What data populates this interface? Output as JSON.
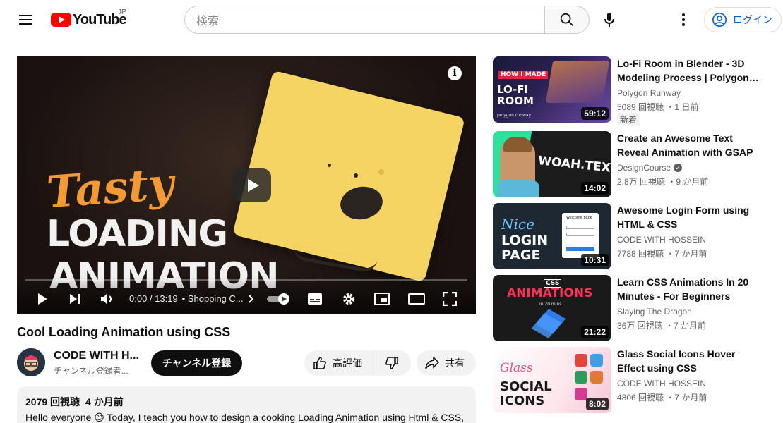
{
  "header": {
    "logo_text": "YouTube",
    "region": "JP",
    "search_placeholder": "検索",
    "login_label": "ログイン",
    "icons": [
      "menu-icon",
      "search-icon",
      "mic-icon",
      "more-vert-icon",
      "account-icon"
    ]
  },
  "player": {
    "thumbnail_text": {
      "line1": "Tasty",
      "line2": "LOADING",
      "line3": "ANIMATION"
    },
    "time": "0:00 / 13:19",
    "chapter": "• Shopping C...",
    "progress": 0
  },
  "video": {
    "title": "Cool Loading Animation using CSS",
    "channel_name": "CODE WITH H...",
    "channel_subs": "チャンネル登録者...",
    "subscribe_label": "チャンネル登録",
    "like_label": "高評価",
    "share_label": "共有",
    "views": "2079 回視聴",
    "published": "4 か月前",
    "description": "Hello everyone 😊 Today, I teach you how to design a cooking Loading Animation using Html & CSS,"
  },
  "related": [
    {
      "title": "Lo-Fi Room in Blender - 3D Modeling Process | Polygon…",
      "channel": "Polygon Runway",
      "verified": false,
      "stats": "5089 回視聴 ・1 日前",
      "badge": "新着",
      "duration": "59:12",
      "thumb_text": [
        "HOW I MADE",
        "LO-FI",
        "ROOM",
        "polygon runway"
      ],
      "colors": [
        "#1a1a3a",
        "#6b4ba8"
      ]
    },
    {
      "title": "Create an Awesome Text Reveal Animation with GSAP",
      "channel": "DesignCourse",
      "verified": true,
      "stats": "2.8万 回視聴 ・9 か月前",
      "duration": "14:02",
      "thumb_text": [
        "WOAH.TEXT"
      ],
      "colors": [
        "#1c1c1c",
        "#2de29a"
      ]
    },
    {
      "title": "Awesome Login Form using HTML & CSS",
      "channel": "CODE WITH HOSSEIN",
      "verified": false,
      "stats": "7788 回視聴 ・7 か月前",
      "duration": "10:31",
      "thumb_text": [
        "Nice",
        "LOGIN",
        "PAGE",
        "Welcome back"
      ],
      "colors": [
        "#1d2833",
        "#6fc3ff"
      ]
    },
    {
      "title": "Learn CSS Animations In 20 Minutes - For Beginners",
      "channel": "Slaying The Dragon",
      "verified": false,
      "stats": "36万 回視聴 ・7 か月前",
      "duration": "21:22",
      "thumb_text": [
        "CSS",
        "ANIMATIONS",
        "in 20 mins"
      ],
      "colors": [
        "#1a1a1a",
        "#ff3355"
      ]
    },
    {
      "title": "Glass Social Icons Hover Effect using CSS",
      "channel": "CODE WITH HOSSEIN",
      "verified": false,
      "stats": "4806 回視聴 ・7 か月前",
      "duration": "8:02",
      "thumb_text": [
        "Glass",
        "SOCIAL",
        "ICONS"
      ],
      "colors": [
        "#fde6ec",
        "#e84a7a"
      ]
    }
  ]
}
